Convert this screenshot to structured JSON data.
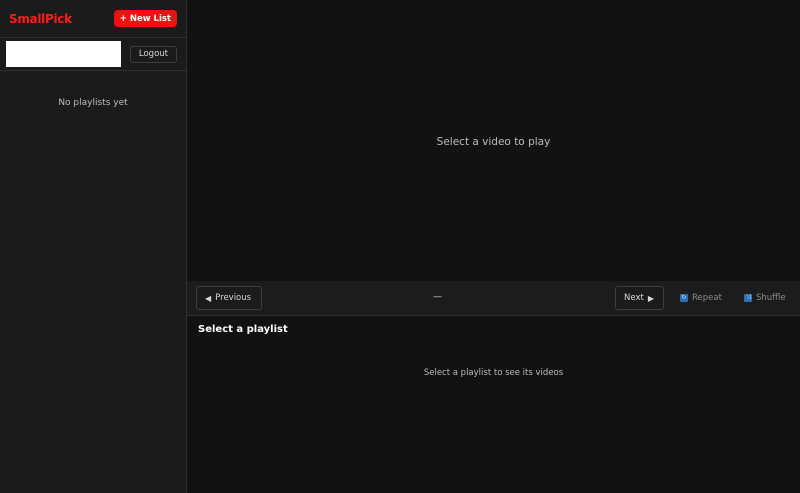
{
  "app": {
    "brand": "SmallPick"
  },
  "sidebar": {
    "new_list_label": "New List",
    "new_list_prefix": "+",
    "logout_label": "Logout",
    "empty_text": "No playlists yet"
  },
  "player": {
    "placeholder": "Select a video to play"
  },
  "controls": {
    "previous_label": "Previous",
    "previous_icon": "◀",
    "next_label": "Next",
    "next_icon": "▶",
    "now_playing": "—",
    "repeat_label": "Repeat",
    "shuffle_label": "Shuffle"
  },
  "videos": {
    "title": "Select a playlist",
    "empty_text": "Select a playlist to see its videos"
  },
  "colors": {
    "accent": "#ee1111",
    "brand": "#ff1a1a",
    "toggle_icon": "#2a6fb3"
  }
}
